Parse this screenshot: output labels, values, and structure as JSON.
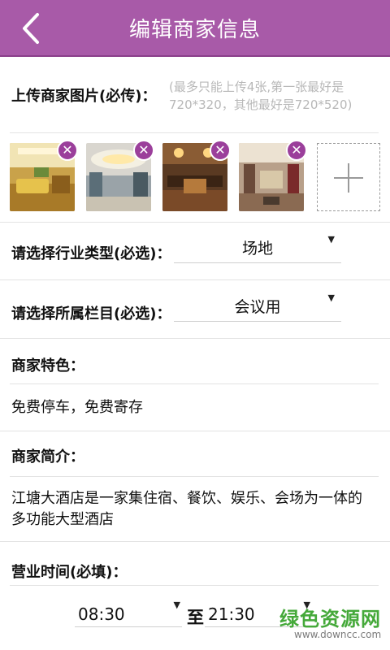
{
  "header": {
    "title": "编辑商家信息"
  },
  "upload": {
    "label": "上传商家图片(必传)：",
    "hint": "(最多只能上传4张,第一张最好是720*320，其他最好是720*520)"
  },
  "industry": {
    "label": "请选择行业类型(必选)：",
    "value": "场地"
  },
  "column": {
    "label": "请选择所属栏目(必选)：",
    "value": "会议用"
  },
  "features": {
    "label": "商家特色：",
    "value": "免费停车，免费寄存"
  },
  "intro": {
    "label": "商家简介：",
    "line1": "江塘大酒店是一家集住宿、餐饮、娱乐、会场为一体的",
    "line2": "多功能大型酒店"
  },
  "hours": {
    "label": "营业时间(必填)：",
    "start": "08:30",
    "to": "至",
    "end": "21:30"
  },
  "watermark": {
    "name": "绿色资源网",
    "url": "www.downcc.com"
  },
  "icons": {
    "back": "back-icon",
    "delete": "close-icon",
    "add": "plus-icon",
    "dropdown": "caret-down-icon"
  },
  "colors": {
    "header": "#a85aa8",
    "delete_badge": "#9b3f9b",
    "watermark": "#45a93a"
  }
}
